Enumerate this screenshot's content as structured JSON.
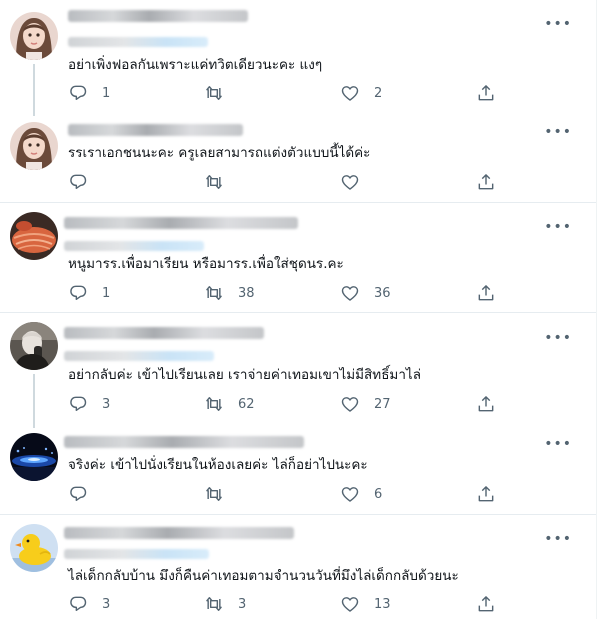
{
  "ui": {
    "more_label": "•••"
  },
  "colors": {
    "icon": "#536471",
    "text": "#0f1419",
    "thread_line": "#cfd9de",
    "divider": "#e6ecf0"
  },
  "icons": {
    "reply": "reply-icon",
    "retweet": "retweet-icon",
    "like": "heart-icon",
    "share": "share-icon"
  },
  "tweets": [
    {
      "avatar": "avatar-woman",
      "text": "อย่าเพิ่งฟอลกันเพราะแค่ทวิตเดียวนะคะ แงๆ",
      "replies": "1",
      "retweets": "",
      "likes": "2"
    },
    {
      "avatar": "avatar-woman",
      "text": "รรเราเอกชนนะคะ ครูเลยสามารถแต่งตัวแบบนี้ได้ค่ะ",
      "replies": "",
      "retweets": "",
      "likes": ""
    },
    {
      "avatar": "avatar-salmon",
      "text": "หนูมารร.เพื่อมาเรียน หรือมารร.เพื่อใส่ชุดนร.คะ",
      "replies": "1",
      "retweets": "38",
      "likes": "36"
    },
    {
      "avatar": "avatar-person",
      "text": "อย่ากลับค่ะ เข้าไปเรียนเลย เราจ่ายค่าเทอมเขาไม่มีสิทธิ์มาไล่",
      "replies": "3",
      "retweets": "62",
      "likes": "27"
    },
    {
      "avatar": "avatar-night-lights",
      "text": "จริงค่ะ เข้าไปนั่งเรียนในห้องเลยค่ะ ไล่ก็อย่าไปนะคะ",
      "replies": "",
      "retweets": "",
      "likes": "6"
    },
    {
      "avatar": "avatar-rubber-duck",
      "text": "ไล่เด็กกลับบ้าน มึงก็คืนค่าเทอมตามจำนวนวันที่มึงไล่เด็กกลับด้วยนะ",
      "replies": "3",
      "retweets": "3",
      "likes": "13"
    }
  ]
}
